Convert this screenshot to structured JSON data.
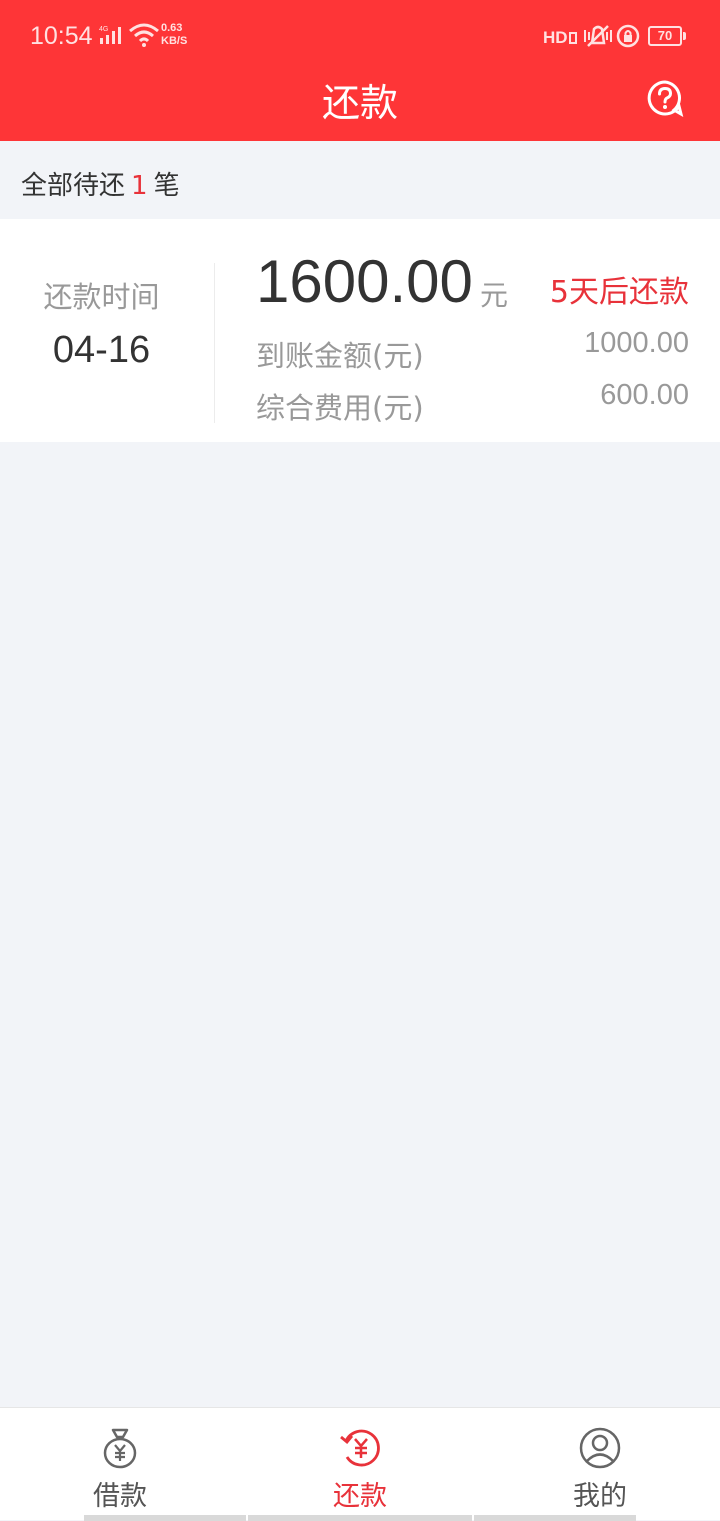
{
  "status_bar": {
    "time": "10:54",
    "network": "4G",
    "speed_value": "0.63",
    "speed_unit": "KB/S",
    "battery": "70"
  },
  "header": {
    "title": "还款",
    "accent_color": "#fe3537"
  },
  "summary": {
    "prefix": "全部待还",
    "count": "1",
    "suffix": "笔"
  },
  "loan": {
    "due_label": "还款时间",
    "due_date": "04-16",
    "amount": "1600.00",
    "amount_unit": "元",
    "days_left": "5天后还款",
    "received_label": "到账金额(元)",
    "received_value": "1000.00",
    "fee_label": "综合费用(元)",
    "fee_value": "600.00"
  },
  "tabs": [
    {
      "label": "借款",
      "icon": "money-bag-icon",
      "active": false
    },
    {
      "label": "还款",
      "icon": "repay-icon",
      "active": true
    },
    {
      "label": "我的",
      "icon": "user-icon",
      "active": false
    }
  ]
}
